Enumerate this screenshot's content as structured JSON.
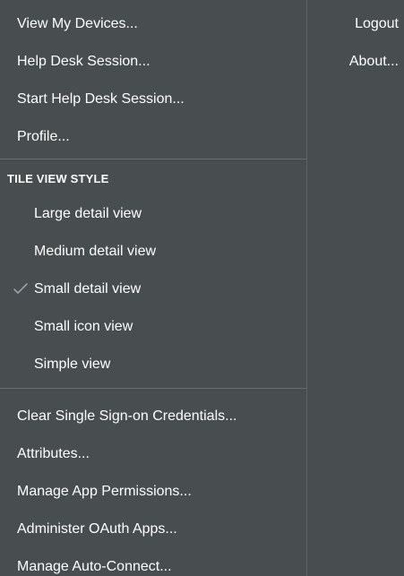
{
  "menu": {
    "top_items": [
      {
        "label": "View My Devices..."
      },
      {
        "label": "Help Desk Session..."
      },
      {
        "label": "Start Help Desk Session..."
      },
      {
        "label": "Profile..."
      }
    ],
    "tile_view_header": "TILE VIEW STYLE",
    "tile_view_items": [
      {
        "label": "Large detail view",
        "checked": false
      },
      {
        "label": "Medium detail view",
        "checked": false
      },
      {
        "label": "Small detail view",
        "checked": true
      },
      {
        "label": "Small icon view",
        "checked": false
      },
      {
        "label": "Simple view",
        "checked": false
      }
    ],
    "bottom_items": [
      {
        "label": "Clear Single Sign-on Credentials..."
      },
      {
        "label": "Attributes..."
      },
      {
        "label": "Manage App Permissions..."
      },
      {
        "label": "Administer OAuth Apps..."
      },
      {
        "label": "Manage Auto-Connect..."
      }
    ],
    "right_items": [
      {
        "label": "Logout"
      },
      {
        "label": "About..."
      }
    ],
    "colors": {
      "background": "#484d50",
      "text": "#ffffff",
      "checkmark": "#9aa0a4"
    },
    "check_icon": "checkmark-icon"
  }
}
